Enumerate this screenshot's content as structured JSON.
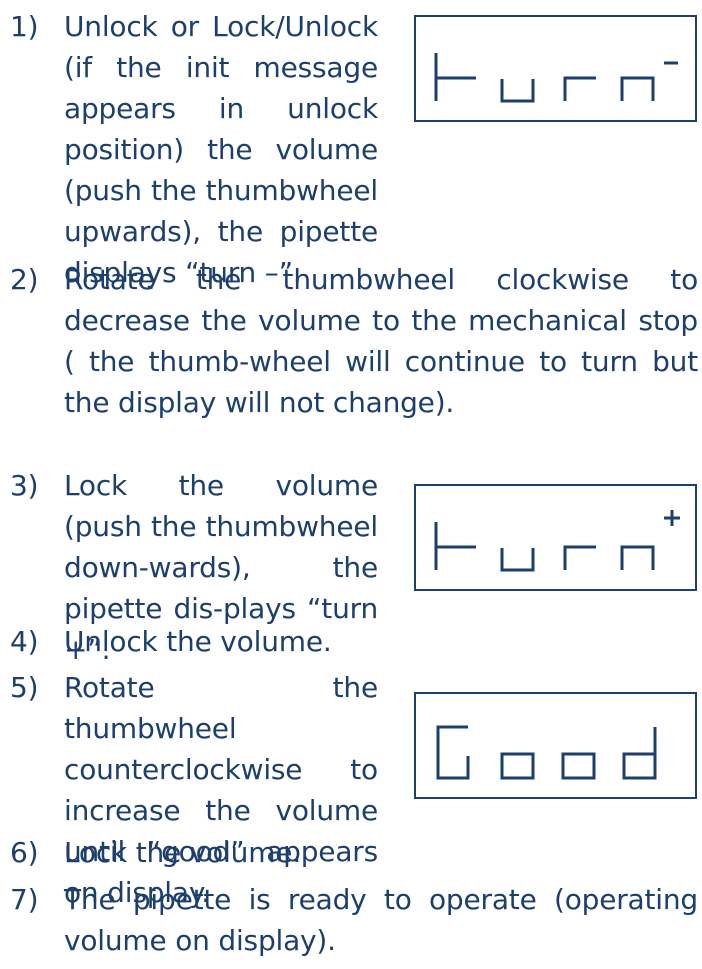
{
  "steps": [
    {
      "number": "1)",
      "text": "Unlock or Lock/Unlock (if the init message appears in unlock position) the volume (push the thumbwheel upwards), the pipette displays “turn –”."
    },
    {
      "number": "2)",
      "text": "Rotate the thumbwheel clockwise to decrease the volume to the mechanical stop ( the thumb-wheel will continue to turn but the display will not change)."
    },
    {
      "number": "3)",
      "text": "Lock the volume (push the thumbwheel down-wards), the pipette dis-plays “turn +”."
    },
    {
      "number": "4)",
      "text": "Unlock the volume."
    },
    {
      "number": "5)",
      "text": "Rotate the thumbwheel counterclockwise to increase the volume until “good” appears on display."
    },
    {
      "number": "6)",
      "text": "Lock the volume."
    },
    {
      "number": "7)",
      "text": "The pipette is ready to operate (operating volume on display)."
    }
  ],
  "displays": [
    {
      "text": "turn -"
    },
    {
      "text": "turn +"
    },
    {
      "text": "Good"
    }
  ],
  "colors": {
    "ink": "#1c3f6e"
  }
}
